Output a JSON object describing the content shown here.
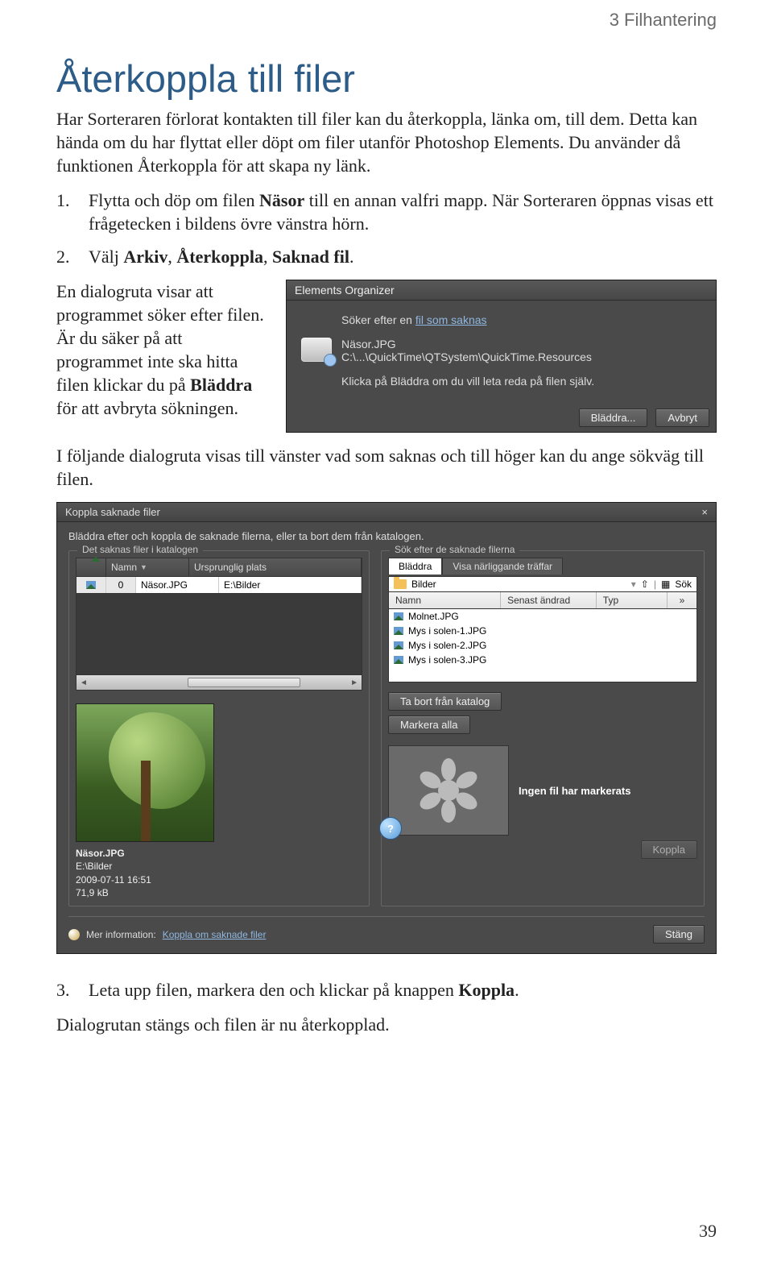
{
  "chapter": "3 Filhantering",
  "title": "Återkoppla till filer",
  "intro1": "Har Sorteraren förlorat kontakten till filer kan du återkoppla, länka om, till dem. Detta kan hända om du har flyttat eller döpt om filer utanför Photoshop Elements. Du använder då funktionen Återkoppla för att skapa ny länk.",
  "step1_a": "Flytta och döp om filen ",
  "step1_b": "Näsor",
  "step1_c": " till en annan valfri mapp. När Sorteraren öppnas visas ett frågetecken i bildens övre vänstra hörn.",
  "step2_a": "Välj ",
  "step2_b": "Arkiv",
  "step2_c": ", ",
  "step2_d": "Återkoppla",
  "step2_e": ", ",
  "step2_f": "Saknad fil",
  "step2_g": ".",
  "para_dialog_a": "En dialogruta visar att programmet söker efter filen. Är du säker på att programmet inte ska hitta filen klickar du på ",
  "para_dialog_b": "Bläddra",
  "para_dialog_c": " för att avbryta sökningen.",
  "dlg_eo": {
    "title": "Elements Organizer",
    "search_a": "Söker efter en ",
    "search_link": "fil som saknas",
    "file": "Näsor.JPG",
    "path": "C:\\...\\QuickTime\\QTSystem\\QuickTime.Resources",
    "instr": "Klicka på Bläddra om du vill leta reda på filen själv.",
    "btn_browse": "Bläddra...",
    "btn_cancel": "Avbryt"
  },
  "para_next": "I följande dialogruta visas till vänster vad som saknas och till höger kan du ange sökväg till filen.",
  "dlg_ks": {
    "title": "Koppla saknade filer",
    "intro": "Bläddra efter och koppla de saknade filerna, eller ta bort dem från katalogen.",
    "left_legend": "Det saknas filer i katalogen",
    "right_legend": "Sök efter de saknade filerna",
    "col_name": "Namn",
    "col_orig": "Ursprunglig plats",
    "row_zero": "0",
    "row_name": "Näsor.JPG",
    "row_path": "E:\\Bilder",
    "btn_remove": "Ta bort från katalog",
    "btn_selectall": "Markera alla",
    "meta_name": "Näsor.JPG",
    "meta_path": "E:\\Bilder",
    "meta_date": "2009-07-11 16:51",
    "meta_size": "71,9 kB",
    "tab_browse": "Bläddra",
    "tab_near": "Visa närliggande träffar",
    "loc": "Bilder",
    "loc_up": "⇧",
    "loc_search": "Sök",
    "fh_name": "Namn",
    "fh_date": "Senast ändrad",
    "fh_type": "Typ",
    "files": [
      "Molnet.JPG",
      "Mys i solen-1.JPG",
      "Mys i solen-2.JPG",
      "Mys i solen-3.JPG"
    ],
    "none_msg": "Ingen fil har markerats",
    "btn_connect": "Koppla",
    "more_label": "Mer information:",
    "more_link": "Koppla om saknade filer",
    "btn_close": "Stäng"
  },
  "step3_a": "Leta upp filen, markera den och klickar på knappen ",
  "step3_b": "Koppla",
  "step3_c": ".",
  "closing": "Dialogrutan stängs och filen är nu återkopplad.",
  "page_num": "39"
}
